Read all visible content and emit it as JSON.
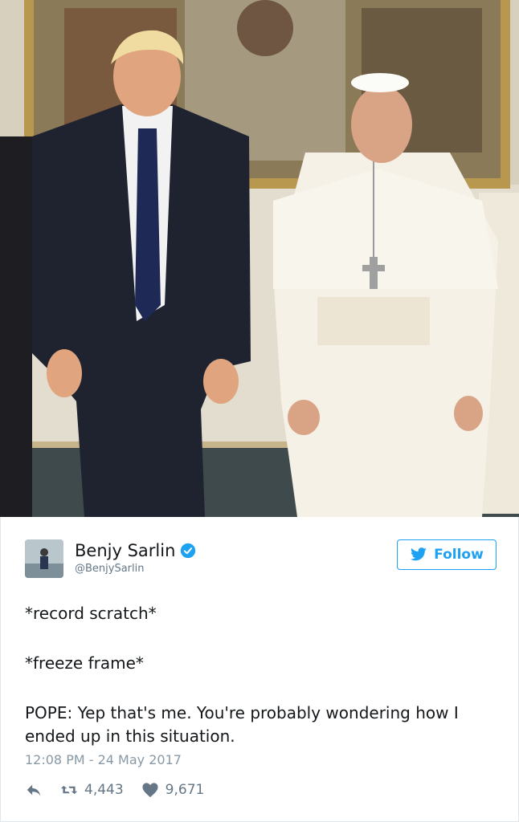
{
  "photo": {
    "alt_icon": "photo-trump-and-pope"
  },
  "tweet": {
    "author_name": "Benjy Sarlin",
    "author_handle": "@BenjySarlin",
    "follow_label": "Follow",
    "text_lines": [
      "*record scratch*",
      "*freeze frame*",
      "POPE: Yep that's me. You're probably wondering how I ended up in this situation."
    ],
    "timestamp": "12:08 PM - 24 May 2017",
    "retweets": "4,443",
    "likes": "9,671"
  },
  "colors": {
    "twitter_blue": "#1da1f2",
    "text": "#14171a",
    "muted": "#657786",
    "timestamp": "#8899a6",
    "like_heart": "#657786"
  },
  "icons": {
    "verified": "verified-badge-icon",
    "follow_bird": "twitter-bird-icon",
    "reply": "reply-icon",
    "retweet": "retweet-icon",
    "like": "heart-icon"
  }
}
